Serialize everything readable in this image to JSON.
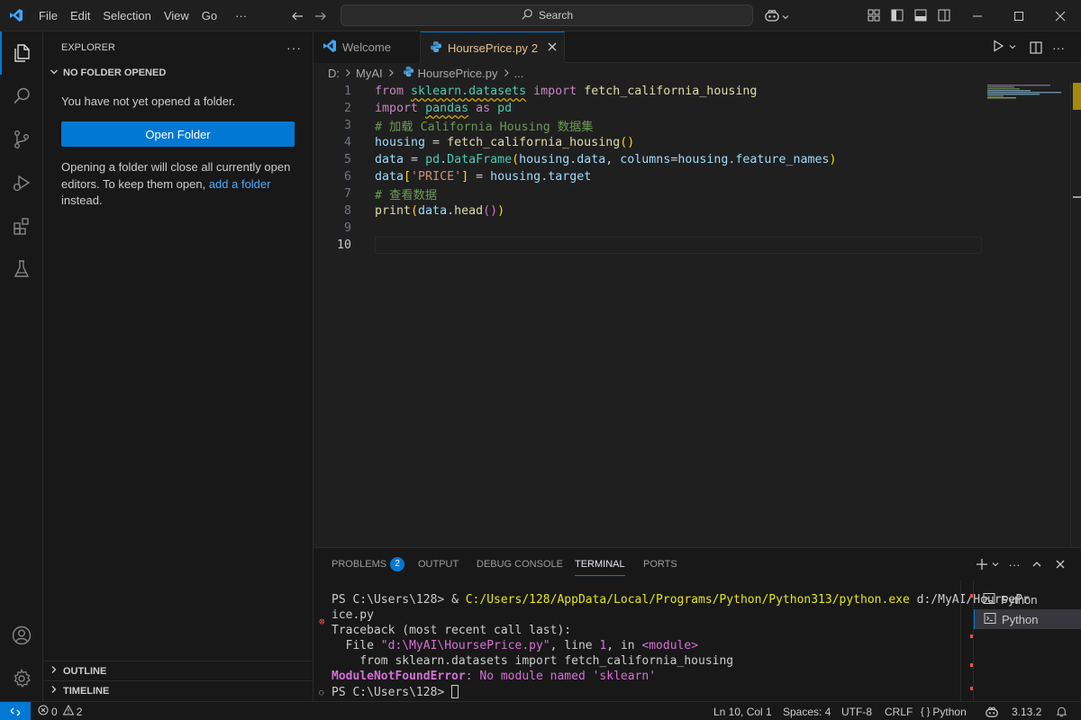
{
  "menu": [
    "File",
    "Edit",
    "Selection",
    "View",
    "Go",
    "···"
  ],
  "search": {
    "label": "Search"
  },
  "sidebar": {
    "title": "EXPLORER",
    "more": "···",
    "section": "NO FOLDER OPENED",
    "message": "You have not yet opened a folder.",
    "open_button": "Open Folder",
    "note_before": "Opening a folder will close all currently open editors. To keep them open, ",
    "note_link": "add a folder",
    "note_after": " instead.",
    "outline": "OUTLINE",
    "timeline": "TIMELINE"
  },
  "tabs": [
    {
      "label": "Welcome"
    },
    {
      "label": "HoursePrice.py",
      "badge": "2"
    }
  ],
  "breadcrumb": {
    "drive": "D:",
    "folder": "MyAI",
    "file": "HoursePrice.py",
    "more": "..."
  },
  "code": {
    "line_numbers": [
      "1",
      "2",
      "3",
      "4",
      "5",
      "6",
      "7",
      "8",
      "9",
      "10"
    ],
    "l1": {
      "kw1": "from",
      "mod": "sklearn.datasets",
      "kw2": "import",
      "fn": "fetch_california_housing"
    },
    "l2": {
      "kw1": "import",
      "mod": "pandas",
      "kw2": "as",
      "alias": "pd"
    },
    "l3": {
      "comment": "# 加载 California Housing 数据集"
    },
    "l4": {
      "var": "housing",
      "op": " = ",
      "fn": "fetch_california_housing",
      "b1": "(",
      "b2": ")"
    },
    "l5": {
      "var": "data",
      "op": " = ",
      "mod": "pd",
      "dot": ".",
      "cls": "DataFrame",
      "b1": "(",
      "arg1": "housing",
      "d1": ".",
      "attr1": "data",
      "comma": ", ",
      "kwarg": "columns",
      "eq": "=",
      "arg2": "housing",
      "d2": ".",
      "attr2": "feature_names",
      "b2": ")"
    },
    "l6": {
      "var": "data",
      "b1": "[",
      "str": "'PRICE'",
      "b2": "]",
      "op": " = ",
      "arg": "housing",
      "dot": ".",
      "attr": "target"
    },
    "l7": {
      "comment": "# 查看数据"
    },
    "l8": {
      "fn": "print",
      "b1": "(",
      "var": "data",
      "dot": ".",
      "fn2": "head",
      "b2": "(",
      "b3": ")",
      "b4": ")"
    }
  },
  "panel": {
    "tabs": [
      "PROBLEMS",
      "OUTPUT",
      "DEBUG CONSOLE",
      "TERMINAL",
      "PORTS"
    ],
    "problems_count": "2",
    "terminals": [
      "Python",
      "Python"
    ]
  },
  "terminal": {
    "prompt1": "PS C:\\Users\\128> ",
    "amp": "& ",
    "exe": "C:/Users/128/AppData/Local/Programs/Python/Python313/python.exe",
    "script_a": " d:/MyAI/HoursePr",
    "script_b": "ice.py",
    "traceback": "Traceback (most recent call last):",
    "file_prefix": "  File ",
    "file_path": "\"d:\\MyAI\\HoursePrice.py\"",
    "file_mid": ", line ",
    "file_line": "1",
    "file_in": ", in ",
    "file_module": "<module>",
    "src": "    from sklearn.datasets import fetch_california_housing",
    "err_type": "ModuleNotFoundError",
    "err_colon": ": ",
    "err_msg": "No module named 'sklearn'",
    "prompt2": "PS C:\\Users\\128> "
  },
  "status": {
    "errors": "0",
    "warnings": "2",
    "position": "Ln 10, Col 1",
    "spaces": "Spaces: 4",
    "encoding": "UTF-8",
    "eol": "CRLF",
    "language": "Python",
    "version": "3.13.2"
  },
  "colors": {
    "accent": "#0078d4",
    "modified_tab": "#e2c08d",
    "error": "#f14c4c"
  }
}
